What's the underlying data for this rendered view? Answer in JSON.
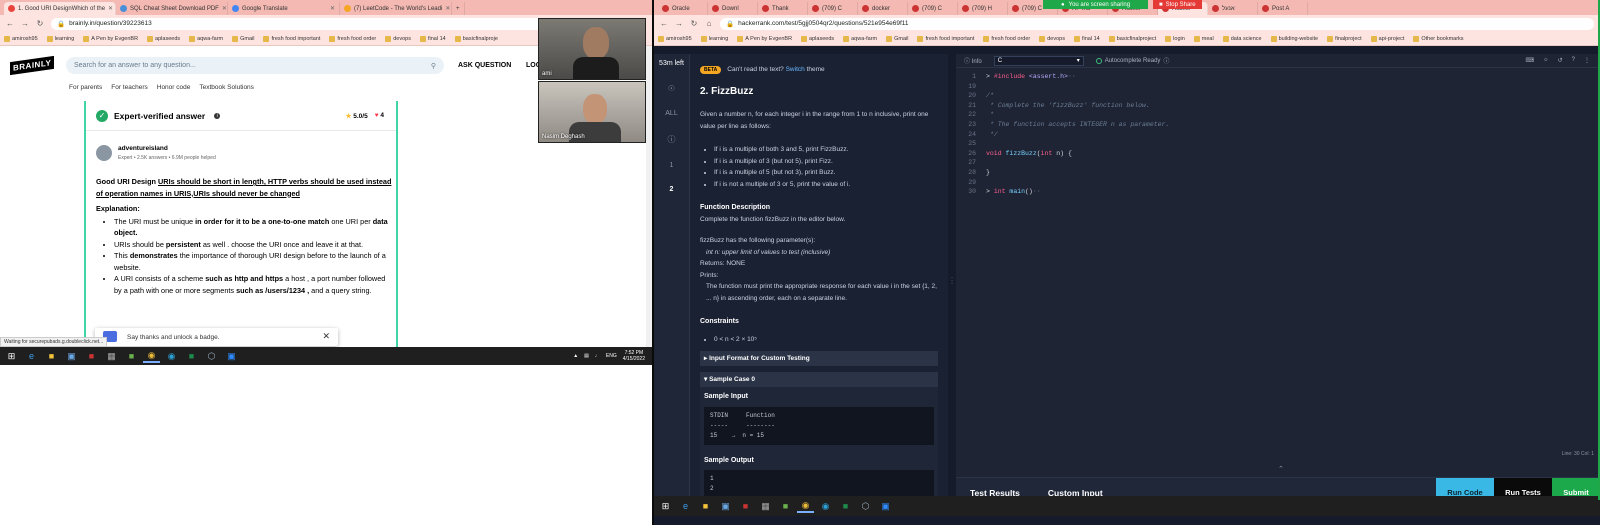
{
  "left_browser": {
    "tabs": [
      {
        "label": "1. Good URI DesignWhich of the",
        "active": true,
        "color": "#e8453c"
      },
      {
        "label": "SQL Cheat Sheet Download PDF",
        "active": false,
        "color": "#4a90d9"
      },
      {
        "label": "Google Translate",
        "active": false,
        "color": "#4285f4"
      },
      {
        "label": "(7) LeetCode - The World's Leadi",
        "active": false,
        "color": "#f5a623"
      }
    ],
    "url": "brainly.in/question/39223613",
    "bookmarks": [
      "amirosh95",
      "learning",
      "A Pen by EvgenBR",
      "aplaseeds",
      "aqwa-farm",
      "Gmail",
      "fresh food important",
      "fresh food order",
      "devops",
      "final 14",
      "basicfinalproje"
    ],
    "status_text": "Waiting for securepubads.g.doubleclick.net..."
  },
  "brainly": {
    "logo": "BRAINLY",
    "search_placeholder": "Search for an answer to any question...",
    "ask_question": "ASK QUESTION",
    "login": "LOG",
    "subnav": [
      "For parents",
      "For teachers",
      "Honor code",
      "Textbook Solutions"
    ],
    "card": {
      "title": "Expert-verified answer",
      "rating": "5.0/5",
      "likes": "4",
      "author": "adventureisland",
      "author_meta": "Expert • 2.5K answers • 6.9M people helped",
      "headline_prefix": "Good URI Design ",
      "headline_link": "URIs should be short in length, HTTP verbs should be used instead of operation names in URIS,URIs should never be changed",
      "explanation_label": "Explanation:",
      "bullets": [
        {
          "a": "The URI must be unique ",
          "b": "in order for it to be a one-to-one match",
          "c": " one URI per ",
          "d": "data object."
        },
        {
          "a": "URIs should be ",
          "b": "persistent",
          "c": " as well . choose the URI once and leave it at that.",
          "d": ""
        },
        {
          "a": "This ",
          "b": "demonstrates",
          "c": " the importance of thorough URI design before to the launch of a website.",
          "d": ""
        },
        {
          "a": "A URI consists of a scheme ",
          "b": "such as http and https",
          "c": " a host , a port number followed by a path with one or more segments ",
          "d": "such as /users/1234 ,"
        },
        {
          "a": "",
          "b": "",
          "c": " and a query string.",
          "d": ""
        }
      ]
    },
    "toast": "Say thanks and unlock a badge."
  },
  "webcams": [
    {
      "name": "ami"
    },
    {
      "name": "Nasim Deghash"
    }
  ],
  "left_taskbar": {
    "lang": "ENG",
    "time": "7:52 PM",
    "date": "4/15/2022"
  },
  "right_browser": {
    "tabs": [
      "Oracle",
      "Downl",
      "Thank",
      "(709) C",
      "docker",
      "(709) C",
      "(709) H",
      "(709) C",
      "HP Ind",
      "Hacker",
      "Hacker",
      "אנעל",
      "Post A"
    ],
    "url": "hackerrank.com/test/5gjj0504qr2/questions/521e954e69f11",
    "bookmarks": [
      "amirosh95",
      "learning",
      "A Pen by EvgenBR",
      "aplaseeds",
      "aqwa-farm",
      "Gmail",
      "fresh food important",
      "fresh food order",
      "devops",
      "final 14",
      "basicfinalproject",
      "login",
      "meal",
      "data science",
      "building-website",
      "finalproject",
      "api-project",
      "Other bookmarks"
    ],
    "sharing": "You are screen sharing",
    "stop_share": "Stop Share"
  },
  "hackerrank": {
    "time_left": "53m left",
    "side_items": [
      "ALL",
      "1",
      "2"
    ],
    "beta_badge": "BETA",
    "beta_text": "Can't read the text?",
    "switch_text": "Switch",
    "theme_text": "theme",
    "problem_title": "2. FizzBuzz",
    "intro": "Given a number n, for each integer i in the range from 1 to n inclusive, print one value per line as follows:",
    "rules": [
      "If i is a multiple of both 3 and 5, print FizzBuzz.",
      "If i is a multiple of 3 (but not 5), print Fizz.",
      "If i is a multiple of 5 (but not 3), print Buzz.",
      "If i is not a multiple of 3 or 5, print the value of i."
    ],
    "func_desc_title": "Function Description",
    "func_desc": "Complete the function fizzBuzz in the editor below.",
    "params_line": "fizzBuzz has the following parameter(s):",
    "param": "int n:  upper limit of values to test (inclusive)",
    "returns": "Returns:     NONE",
    "prints_label": "Prints:",
    "prints_text": "The function must print the appropriate response for each value i in the set {1, 2, ... n} in ascending order, each on a separate line.",
    "constraints_title": "Constraints",
    "constraint": "0 < n < 2 × 10⁵",
    "input_format": "Input Format for Custom Testing",
    "sample_case": "Sample Case 0",
    "sample_input_label": "Sample Input",
    "sample_input": [
      "STDIN     Function",
      "-----     --------",
      "15    →  n = 15"
    ],
    "sample_output_label": "Sample Output",
    "sample_output": [
      "1",
      "2"
    ],
    "editor": {
      "info": "Info",
      "language": "C",
      "autocomplete": "Autocomplete Ready",
      "position": "Line: 30 Col: 1",
      "lines": [
        {
          "n": "1",
          "parts": [
            {
              "c": "tx",
              "t": "> "
            },
            {
              "c": "pre",
              "t": "#include "
            },
            {
              "c": "str",
              "t": "<assert.h>"
            },
            {
              "c": "cm",
              "t": "··"
            }
          ]
        },
        {
          "n": "19",
          "parts": []
        },
        {
          "n": "20",
          "parts": [
            {
              "c": "cm",
              "t": "/*"
            }
          ]
        },
        {
          "n": "21",
          "parts": [
            {
              "c": "cm",
              "t": " * Complete the 'fizzBuzz' function below."
            }
          ]
        },
        {
          "n": "22",
          "parts": [
            {
              "c": "cm",
              "t": " *"
            }
          ]
        },
        {
          "n": "23",
          "parts": [
            {
              "c": "cm",
              "t": " * The function accepts INTEGER n as parameter."
            }
          ]
        },
        {
          "n": "24",
          "parts": [
            {
              "c": "cm",
              "t": " */"
            }
          ]
        },
        {
          "n": "25",
          "parts": []
        },
        {
          "n": "26",
          "parts": [
            {
              "c": "kw",
              "t": "void "
            },
            {
              "c": "fn",
              "t": "fizzBuzz"
            },
            {
              "c": "tx",
              "t": "("
            },
            {
              "c": "kw",
              "t": "int "
            },
            {
              "c": "tx",
              "t": "n) {"
            }
          ]
        },
        {
          "n": "27",
          "parts": []
        },
        {
          "n": "28",
          "parts": [
            {
              "c": "tx",
              "t": "}"
            }
          ]
        },
        {
          "n": "29",
          "parts": []
        },
        {
          "n": "30",
          "parts": [
            {
              "c": "tx",
              "t": "> "
            },
            {
              "c": "kw",
              "t": "int "
            },
            {
              "c": "fn",
              "t": "main"
            },
            {
              "c": "tx",
              "t": "()"
            },
            {
              "c": "cm",
              "t": "··"
            }
          ]
        }
      ]
    },
    "test_results": "Test Results",
    "custom_input": "Custom Input",
    "run_code": "Run Code",
    "run_tests": "Run Tests",
    "submit": "Submit",
    "colors": {
      "run_code": "#39b8e6",
      "run_tests": "#0a0a0a",
      "submit": "#1ba94c"
    }
  }
}
